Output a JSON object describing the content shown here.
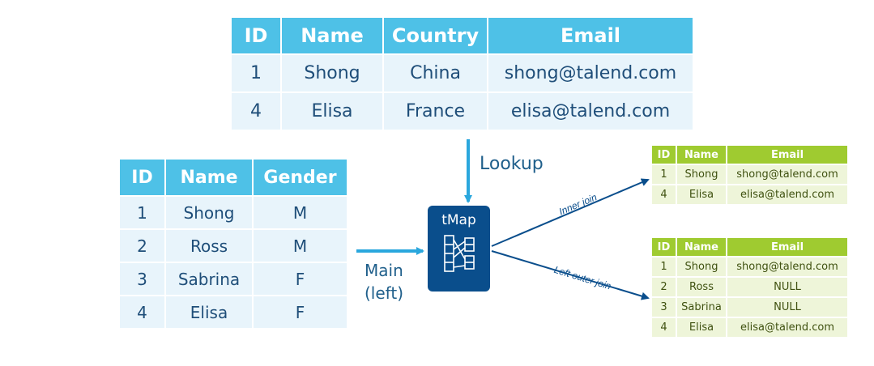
{
  "lookup_table": {
    "headers": [
      "ID",
      "Name",
      "Country",
      "Email"
    ],
    "rows": [
      [
        "1",
        "Shong",
        "China",
        "shong@talend.com"
      ],
      [
        "4",
        "Elisa",
        "France",
        "elisa@talend.com"
      ]
    ]
  },
  "main_table": {
    "headers": [
      "ID",
      "Name",
      "Gender"
    ],
    "rows": [
      [
        "1",
        "Shong",
        "M"
      ],
      [
        "2",
        "Ross",
        "M"
      ],
      [
        "3",
        "Sabrina",
        "F"
      ],
      [
        "4",
        "Elisa",
        "F"
      ]
    ]
  },
  "tmap": {
    "label": "tMap"
  },
  "labels": {
    "lookup": "Lookup",
    "main_line1": "Main",
    "main_line2": "(left)",
    "inner_join": "Inner join",
    "left_outer_join": "Left outer join"
  },
  "inner_join_table": {
    "headers": [
      "ID",
      "Name",
      "Email"
    ],
    "rows": [
      [
        "1",
        "Shong",
        "shong@talend.com"
      ],
      [
        "4",
        "Elisa",
        "elisa@talend.com"
      ]
    ]
  },
  "left_join_table": {
    "headers": [
      "ID",
      "Name",
      "Email"
    ],
    "rows": [
      [
        "1",
        "Shong",
        "shong@talend.com"
      ],
      [
        "2",
        "Ross",
        "NULL"
      ],
      [
        "3",
        "Sabrina",
        "NULL"
      ],
      [
        "4",
        "Elisa",
        "elisa@talend.com"
      ]
    ]
  },
  "colors": {
    "blue_header": "#4ec1e7",
    "blue_cell": "#e8f4fb",
    "green_header": "#9fcb30",
    "green_cell": "#eef5d9",
    "tmap_box": "#0a4e8c",
    "arrow_lookup": "#2aa7dd",
    "arrow_out": "#0a4e8c"
  }
}
